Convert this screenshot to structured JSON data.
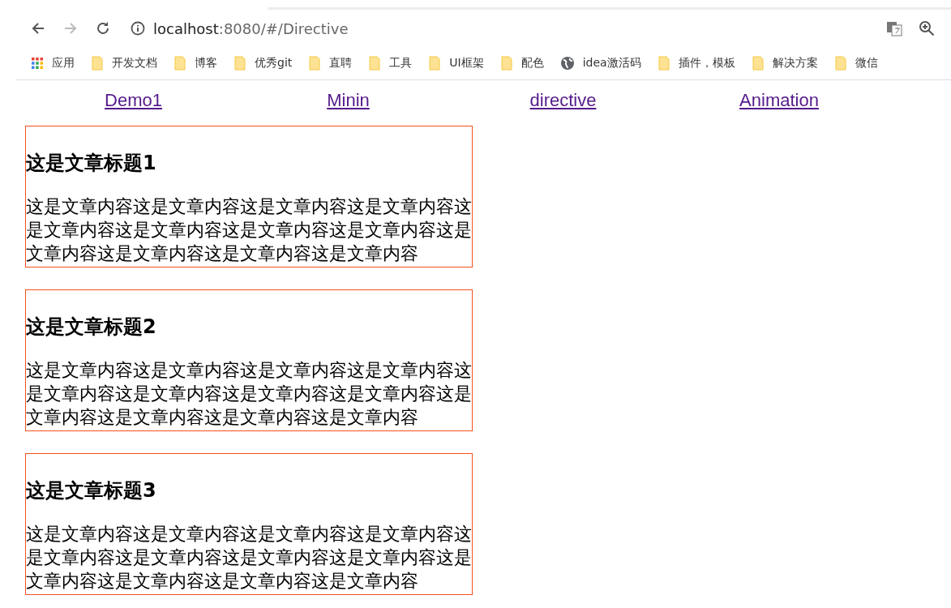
{
  "browser": {
    "url_host": "localhost",
    "url_rest": ":8080/#/Directive",
    "bookmarks": [
      {
        "kind": "apps",
        "label": "应用"
      },
      {
        "kind": "folder",
        "label": "开发文档"
      },
      {
        "kind": "folder",
        "label": "博客"
      },
      {
        "kind": "folder",
        "label": "优秀git"
      },
      {
        "kind": "folder",
        "label": "直聘"
      },
      {
        "kind": "folder",
        "label": "工具"
      },
      {
        "kind": "folder",
        "label": "UI框架"
      },
      {
        "kind": "folder",
        "label": "配色"
      },
      {
        "kind": "globe",
        "label": "idea激活码"
      },
      {
        "kind": "folder",
        "label": "插件，模板"
      },
      {
        "kind": "folder",
        "label": "解决方案"
      },
      {
        "kind": "folder",
        "label": "微信"
      }
    ]
  },
  "nav": [
    "Demo1",
    "Minin",
    "directive",
    "Animation"
  ],
  "articles": [
    {
      "title": "这是文章标题1",
      "body": "这是文章内容这是文章内容这是文章内容这是文章内容这是文章内容这是文章内容这是文章内容这是文章内容这是文章内容这是文章内容这是文章内容这是文章内容"
    },
    {
      "title": "这是文章标题2",
      "body": "这是文章内容这是文章内容这是文章内容这是文章内容这是文章内容这是文章内容这是文章内容这是文章内容这是文章内容这是文章内容这是文章内容这是文章内容"
    },
    {
      "title": "这是文章标题3",
      "body": "这是文章内容这是文章内容这是文章内容这是文章内容这是文章内容这是文章内容这是文章内容这是文章内容这是文章内容这是文章内容这是文章内容这是文章内容"
    }
  ]
}
